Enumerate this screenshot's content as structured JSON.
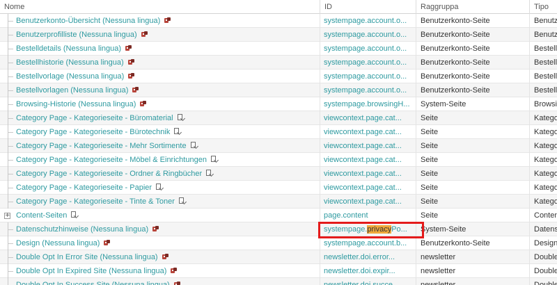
{
  "columns": {
    "name": "Nome",
    "id": "ID",
    "group": "Raggruppa",
    "type": "Tipo"
  },
  "rows": [
    {
      "name": "Benutzerkonto-Übersicht (Nessuna lingua)",
      "icon": "page-red-icon",
      "id_pre": "systempage.account.o...",
      "id_hl": "",
      "id_post": "",
      "group": "Benutzerkonto-Seite",
      "type": "Benutze"
    },
    {
      "name": "Benutzerprofilliste (Nessuna lingua)",
      "icon": "page-red-icon",
      "id_pre": "systempage.account.o...",
      "id_hl": "",
      "id_post": "",
      "group": "Benutzerkonto-Seite",
      "type": "Benutze"
    },
    {
      "name": "Bestelldetails (Nessuna lingua)",
      "icon": "page-red-icon",
      "id_pre": "systempage.account.o...",
      "id_hl": "",
      "id_post": "",
      "group": "Benutzerkonto-Seite",
      "type": "Bestelld"
    },
    {
      "name": "Bestellhistorie (Nessuna lingua)",
      "icon": "page-red-icon",
      "id_pre": "systempage.account.o...",
      "id_hl": "",
      "id_post": "",
      "group": "Benutzerkonto-Seite",
      "type": "Bestellh"
    },
    {
      "name": "Bestellvorlage (Nessuna lingua)",
      "icon": "page-red-icon",
      "id_pre": "systempage.account.o...",
      "id_hl": "",
      "id_post": "",
      "group": "Benutzerkonto-Seite",
      "type": "Bestellv"
    },
    {
      "name": "Bestellvorlagen (Nessuna lingua)",
      "icon": "page-red-icon",
      "id_pre": "systempage.account.o...",
      "id_hl": "",
      "id_post": "",
      "group": "Benutzerkonto-Seite",
      "type": "Bestellv"
    },
    {
      "name": "Browsing-Historie (Nessuna lingua)",
      "icon": "page-red-icon",
      "id_pre": "systempage.browsingH...",
      "id_hl": "",
      "id_post": "",
      "group": "System-Seite",
      "type": "Browsin"
    },
    {
      "name": "Category Page - Kategorieseite - Büromaterial",
      "icon": "category-page-icon",
      "id_pre": "viewcontext.page.cat...",
      "id_hl": "",
      "id_post": "",
      "group": "Seite",
      "type": "Katego"
    },
    {
      "name": "Category Page - Kategorieseite - Bürotechnik",
      "icon": "category-page-icon",
      "id_pre": "viewcontext.page.cat...",
      "id_hl": "",
      "id_post": "",
      "group": "Seite",
      "type": "Katego"
    },
    {
      "name": "Category Page - Kategorieseite - Mehr Sortimente",
      "icon": "category-page-icon",
      "id_pre": "viewcontext.page.cat...",
      "id_hl": "",
      "id_post": "",
      "group": "Seite",
      "type": "Katego"
    },
    {
      "name": "Category Page - Kategorieseite - Möbel & Einrichtungen",
      "icon": "category-page-icon",
      "id_pre": "viewcontext.page.cat...",
      "id_hl": "",
      "id_post": "",
      "group": "Seite",
      "type": "Katego"
    },
    {
      "name": "Category Page - Kategorieseite - Ordner & Ringbücher",
      "icon": "category-page-icon",
      "id_pre": "viewcontext.page.cat...",
      "id_hl": "",
      "id_post": "",
      "group": "Seite",
      "type": "Katego"
    },
    {
      "name": "Category Page - Kategorieseite - Papier",
      "icon": "category-page-icon",
      "id_pre": "viewcontext.page.cat...",
      "id_hl": "",
      "id_post": "",
      "group": "Seite",
      "type": "Katego"
    },
    {
      "name": "Category Page - Kategorieseite - Tinte & Toner",
      "icon": "category-page-icon",
      "id_pre": "viewcontext.page.cat...",
      "id_hl": "",
      "id_post": "",
      "group": "Seite",
      "type": "Katego"
    },
    {
      "name": "Content-Seiten",
      "icon": "category-page-icon",
      "expander": "+",
      "id_pre": "page.content",
      "id_hl": "",
      "id_post": "",
      "group": "Seite",
      "type": "Content"
    },
    {
      "name": "Datenschutzhinweise (Nessuna lingua)",
      "icon": "page-red-icon",
      "id_pre": "systempage.",
      "id_hl": "privacy",
      "id_post": "Po...",
      "group": "System-Seite",
      "type": "Datensc"
    },
    {
      "name": "Design (Nessuna lingua)",
      "icon": "page-red-icon",
      "id_pre": "systempage.account.b...",
      "id_hl": "",
      "id_post": "",
      "group": "Benutzerkonto-Seite",
      "type": "Design"
    },
    {
      "name": "Double Opt In Error Site (Nessuna lingua)",
      "icon": "page-red-icon",
      "id_pre": "newsletter.doi.error...",
      "id_hl": "",
      "id_post": "",
      "group": "newsletter",
      "type": "Double"
    },
    {
      "name": "Double Opt In Expired Site (Nessuna lingua)",
      "icon": "page-red-icon",
      "id_pre": "newsletter.doi.expir...",
      "id_hl": "",
      "id_post": "",
      "group": "newsletter",
      "type": "Double"
    },
    {
      "name": "Double Opt In Success Site (Nessuna lingua)",
      "icon": "page-red-icon",
      "id_pre": "newsletter.doi.succe...",
      "id_hl": "",
      "id_post": "",
      "group": "newsletter",
      "type": "Double"
    }
  ],
  "colors": {
    "link": "#2e9aa0",
    "highlight": "#f0a93b",
    "annotation": "#e41b1b"
  }
}
